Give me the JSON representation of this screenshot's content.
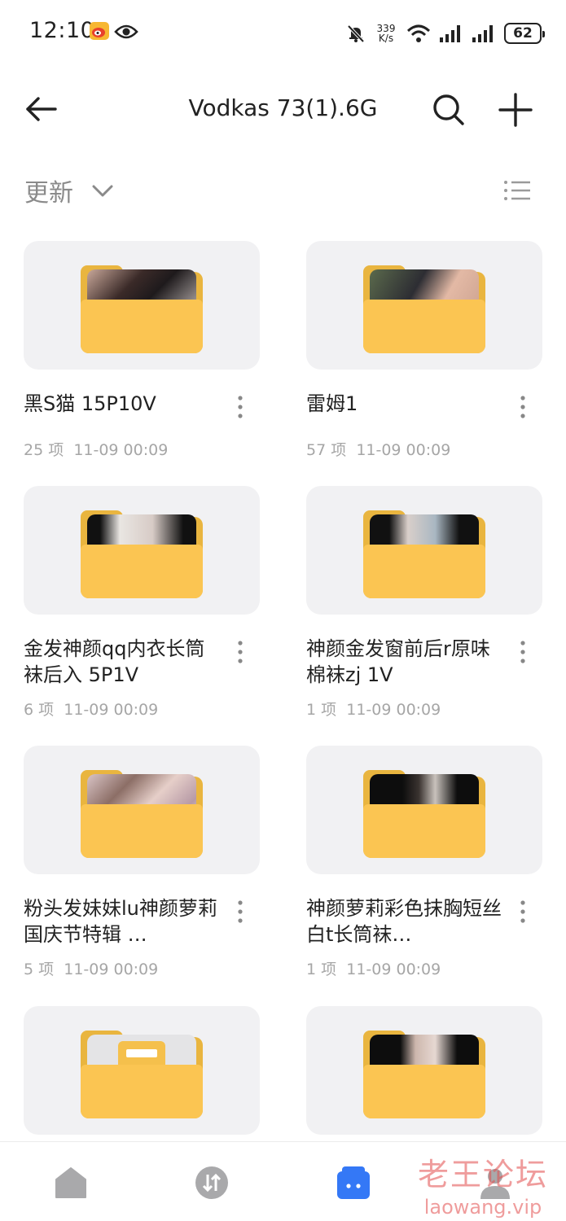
{
  "status_bar": {
    "time": "12:10",
    "net_speed_value": "339",
    "net_speed_unit": "K/s",
    "battery": "62"
  },
  "header": {
    "title": "Vodkas 73(1).6G"
  },
  "sort": {
    "label": "更新"
  },
  "folders": [
    {
      "name": "黑S猫 15P10V",
      "count": "25 项",
      "date": "11-09 00:09",
      "preview": "photo"
    },
    {
      "name": "雷姆1",
      "count": "57 项",
      "date": "11-09 00:09",
      "preview": "photo"
    },
    {
      "name": "金发神颜qq内衣长筒袜后入 5P1V",
      "count": "6 项",
      "date": "11-09 00:09",
      "preview": "photo"
    },
    {
      "name": "神颜金发窗前后r原味棉袜zj 1V",
      "count": "1 项",
      "date": "11-09 00:09",
      "preview": "photo"
    },
    {
      "name": "粉头发妹妹lu神颜萝莉国庆节特辑 …",
      "count": "5 项",
      "date": "11-09 00:09",
      "preview": "photo"
    },
    {
      "name": "神颜萝莉彩色抹胸短丝白t长筒袜…",
      "count": "1 项",
      "date": "11-09 00:09",
      "preview": "photo"
    },
    {
      "name": "",
      "count": "",
      "date": "",
      "preview": "folder"
    },
    {
      "name": "",
      "count": "",
      "date": "",
      "preview": "photo"
    }
  ],
  "bottom_nav": [
    {
      "name": "home",
      "icon": "home-icon"
    },
    {
      "name": "transfer",
      "icon": "transfer-icon"
    },
    {
      "name": "files",
      "icon": "files-icon",
      "active": true
    },
    {
      "name": "profile",
      "icon": "profile-icon"
    }
  ],
  "watermark": {
    "cn": "老王论坛",
    "en": "laowang.vip"
  },
  "colors": {
    "folder_front": "#fbc552",
    "folder_back": "#e9b53f",
    "card_bg": "#f1f1f3",
    "active_nav": "#3478f6",
    "meta_text": "#a6a6a6"
  }
}
